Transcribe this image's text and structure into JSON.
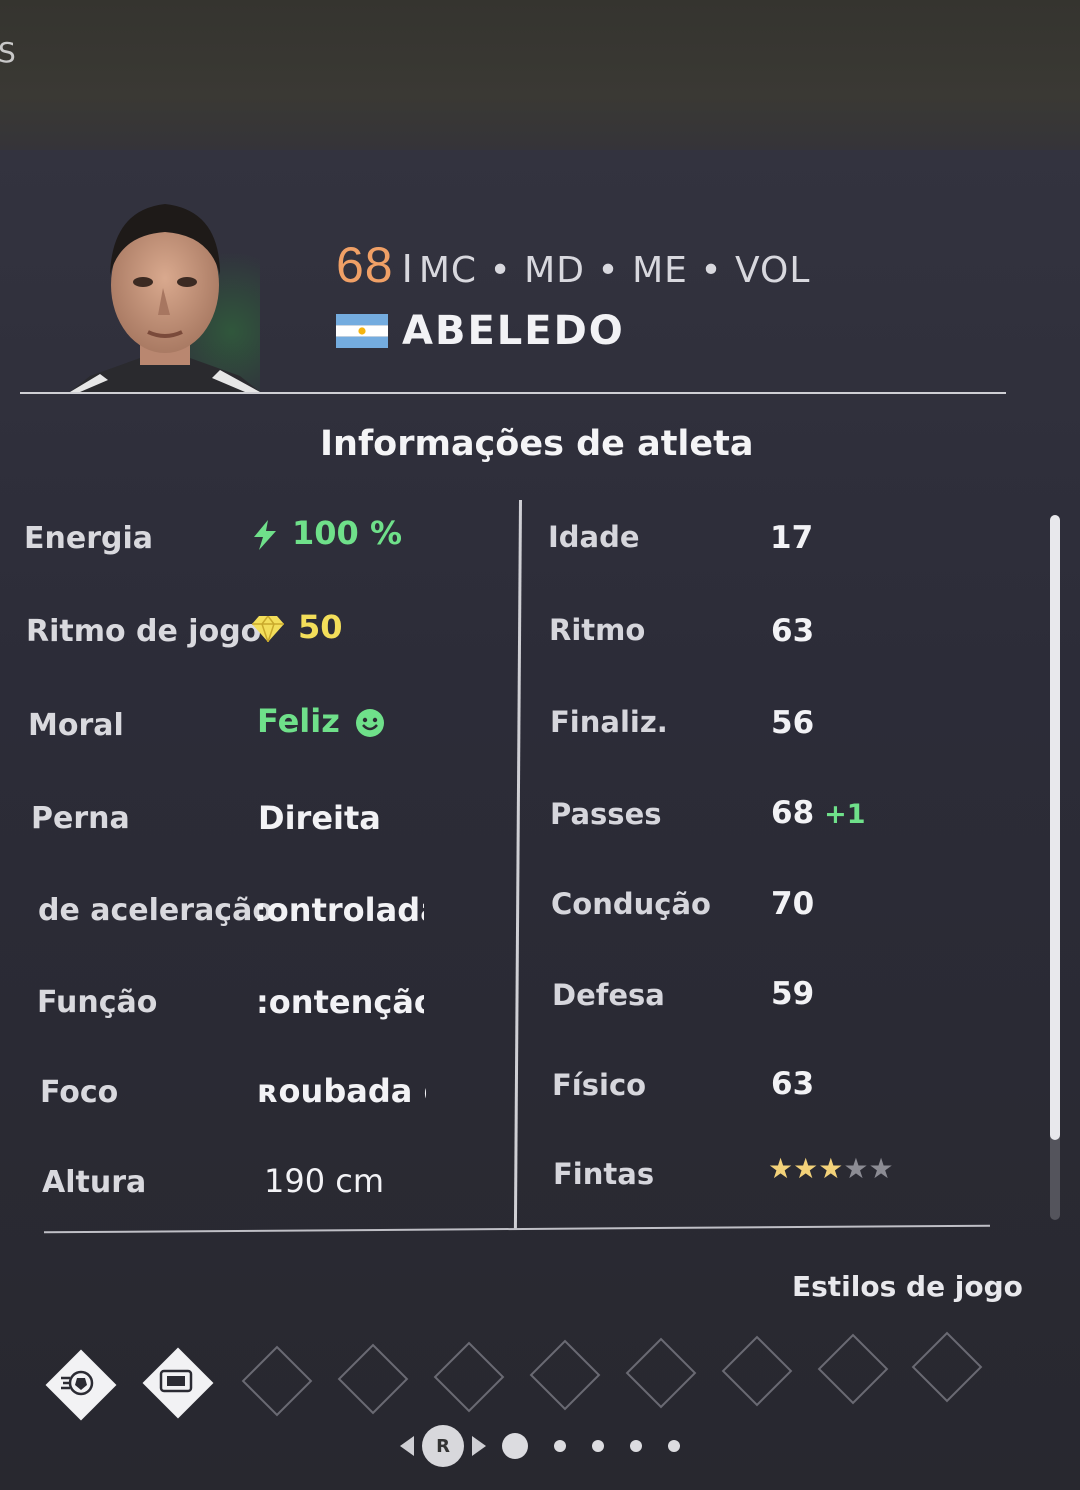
{
  "screen_edge_letter": "S",
  "header": {
    "overall": "68",
    "separator": "I",
    "positions": "MC • MD • ME • VOL",
    "player_name": "ABELEDO",
    "flag_icon": "argentina-flag-icon"
  },
  "section_title": "Informações de atleta",
  "left_rows": [
    {
      "label": "Energia",
      "value": "100 %",
      "icon": "lightning-icon",
      "color": "#6fe08a"
    },
    {
      "label": "Ritmo de jogo",
      "value": "50",
      "icon": "diamond-icon",
      "color": "#f3de5a"
    },
    {
      "label": "Moral",
      "value": "Feliz",
      "icon": "smiley-icon",
      "color": "#6fe08a"
    },
    {
      "label": "Perna",
      "value": "Direita"
    },
    {
      "label": "de aceleração",
      "value": ":ontrolada"
    },
    {
      "label": "Função",
      "value": ":ontenção"
    },
    {
      "label": "Foco",
      "value": "ʀoubada de"
    },
    {
      "label": "Altura",
      "value": "190 cm"
    }
  ],
  "right_rows": [
    {
      "label": "Idade",
      "value": "17"
    },
    {
      "label": "Ritmo",
      "value": "63"
    },
    {
      "label": "Finaliz.",
      "value": "56"
    },
    {
      "label": "Passes",
      "value": "68",
      "boost": "+1"
    },
    {
      "label": "Condução",
      "value": "70"
    },
    {
      "label": "Defesa",
      "value": "59",
      "color": "#f0b35a"
    },
    {
      "label": "Físico",
      "value": "63",
      "color": "#f0b35a"
    },
    {
      "label": "Fintas",
      "stars_filled": 3,
      "stars_total": 5
    }
  ],
  "styles_label": "Estilos de jogo",
  "playstyles": {
    "filled_icons": [
      "ball-play-icon",
      "ticket-play-icon"
    ],
    "empty_slots": 8
  },
  "pager": {
    "button_label": "R",
    "page_count": 5,
    "current_page": 1
  },
  "colors": {
    "overall": "#f0a066",
    "green": "#6fe08a",
    "yellow": "#f3de5a",
    "orange": "#f0b35a"
  }
}
